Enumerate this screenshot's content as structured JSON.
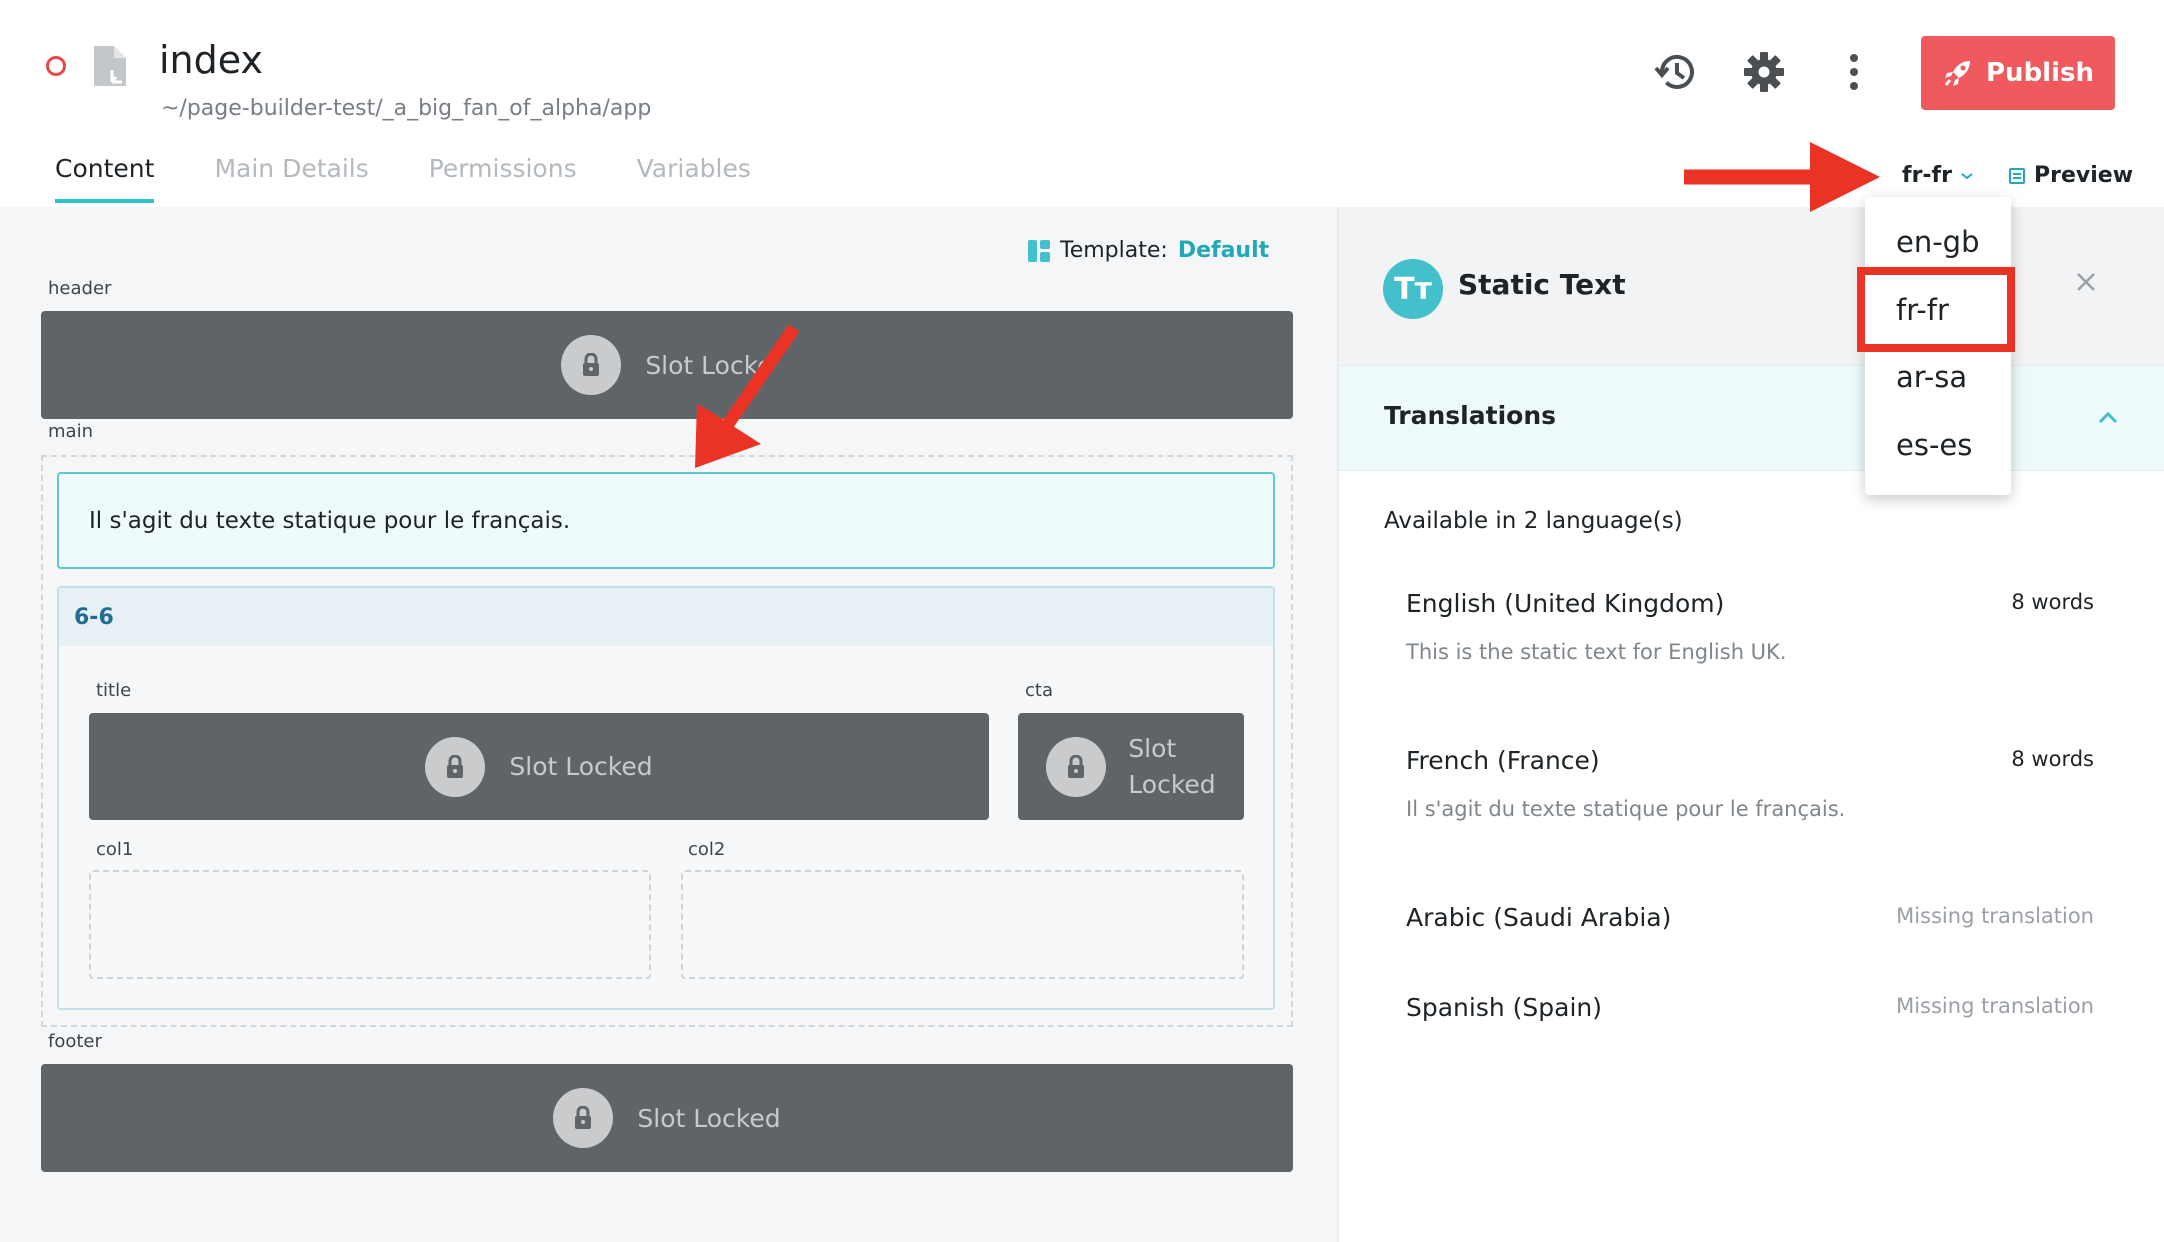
{
  "header": {
    "title": "index",
    "path": "~/page-builder-test/_a_big_fan_of_alpha/app",
    "publish_label": "Publish"
  },
  "tabs": [
    {
      "label": "Content",
      "active": true
    },
    {
      "label": "Main Details",
      "active": false
    },
    {
      "label": "Permissions",
      "active": false
    },
    {
      "label": "Variables",
      "active": false
    }
  ],
  "locale": {
    "current": "fr-fr",
    "options": [
      "en-gb",
      "fr-fr",
      "ar-sa",
      "es-es"
    ]
  },
  "preview_label": "Preview",
  "canvas": {
    "template_label": "Template:",
    "template_value": "Default",
    "header_label": "header",
    "main_label": "main",
    "footer_label": "footer",
    "slot_locked": "Slot Locked",
    "slot_locked_truncated": "Slot Locke",
    "slot_word": "Slot",
    "locked_word": "Locked",
    "static_text": "Il s'agit du texte statique pour le français.",
    "grid_name": "6-6",
    "title_label": "title",
    "cta_label": "cta",
    "col1_label": "col1",
    "col2_label": "col2"
  },
  "panel": {
    "icon_text": "Tт",
    "title": "Static Text",
    "translations_title": "Translations",
    "available": "Available in 2 language(s)",
    "languages": [
      {
        "name": "English (United Kingdom)",
        "count": "8 words",
        "text": "This is the static text for English UK."
      },
      {
        "name": "French (France)",
        "count": "8 words",
        "text": "Il s'agit du texte statique pour le français."
      },
      {
        "name": "Arabic (Saudi Arabia)",
        "status": "Missing translation"
      },
      {
        "name": "Spanish (Spain)",
        "status": "Missing translation"
      }
    ]
  },
  "colors": {
    "accent": "#2cc2cc",
    "publish": "#f05a5f",
    "annotation": "#ea3324",
    "locked_slot": "#5f6469"
  }
}
